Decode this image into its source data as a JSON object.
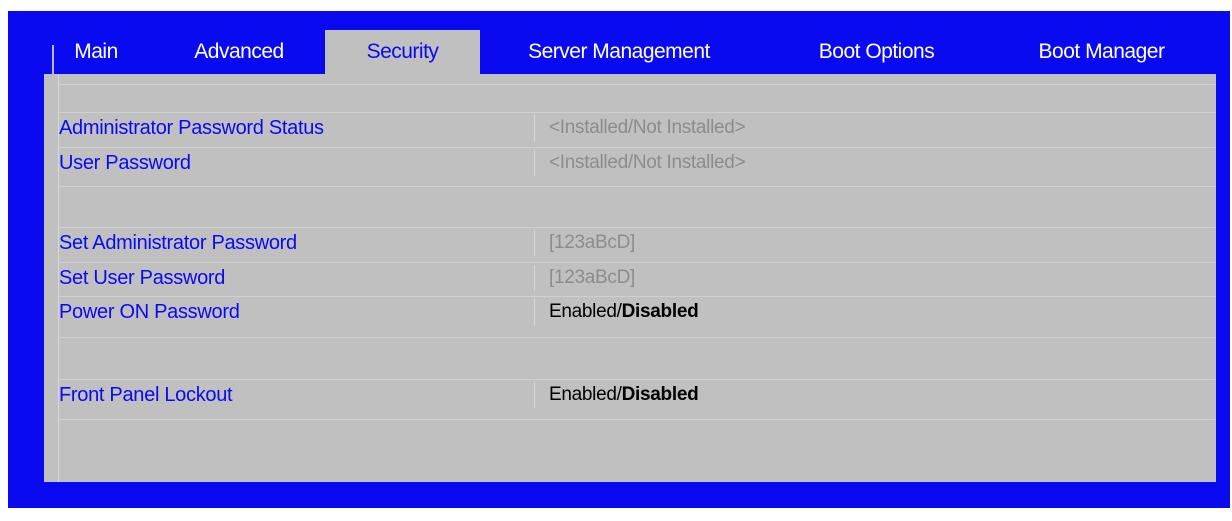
{
  "tabs": [
    {
      "label": "Main"
    },
    {
      "label": "Advanced"
    },
    {
      "label": "Security"
    },
    {
      "label": "Server Management"
    },
    {
      "label": "Boot Options"
    },
    {
      "label": "Boot Manager"
    }
  ],
  "rows": {
    "admin_status": {
      "label": "Administrator Password Status",
      "value": "<Installed/Not Installed>"
    },
    "user_password": {
      "label": "User Password",
      "value": "<Installed/Not Installed>"
    },
    "set_admin": {
      "label": "Set Administrator Password",
      "value": "[123aBcD]"
    },
    "set_user": {
      "label": "Set User Password",
      "value": "[123aBcD]"
    },
    "power_on": {
      "label": "Power ON Password",
      "value_a": "Enabled/",
      "value_b": "Disabled"
    },
    "front_panel": {
      "label": "Front Panel Lockout",
      "value_a": "Enabled/",
      "value_b": "Disabled"
    }
  },
  "colors": {
    "frame": "#0a0af0",
    "panel": "#c0c0c0",
    "label": "#0a0af0",
    "muted_value": "#8c8c8c"
  }
}
